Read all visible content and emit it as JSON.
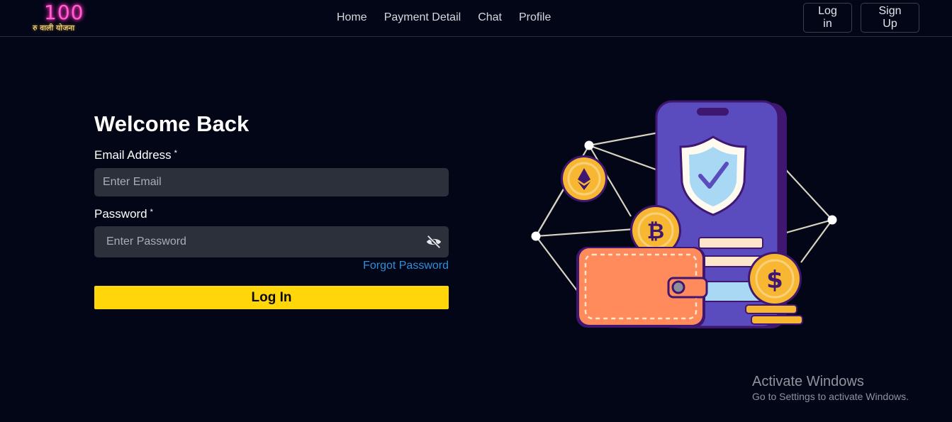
{
  "header": {
    "logo_number": "100",
    "logo_subtitle": "रु वाली योजना",
    "nav_links": [
      "Home",
      "Payment Detail",
      "Chat",
      "Profile"
    ],
    "login_label": "Log in",
    "signup_label": "Sign Up"
  },
  "login_form": {
    "title": "Welcome Back",
    "email_label": "Email Address",
    "required_mark": "*",
    "email_placeholder": "Enter Email",
    "password_label": "Password",
    "password_placeholder": "Enter Password",
    "forgot_label": "Forgot Password",
    "submit_label": "Log In"
  },
  "illustration": {
    "icons": [
      "phone-icon",
      "shield-check-icon",
      "wallet-icon",
      "bitcoin-coin-icon",
      "ethereum-coin-icon",
      "dollar-coin-icon",
      "network-nodes-icon"
    ]
  },
  "watermark": {
    "title": "Activate Windows",
    "subtitle": "Go to Settings to activate Windows."
  },
  "colors": {
    "background": "#020617",
    "accent": "#ffd60a",
    "link": "#2f8fd8",
    "input_bg": "#2c303a"
  }
}
